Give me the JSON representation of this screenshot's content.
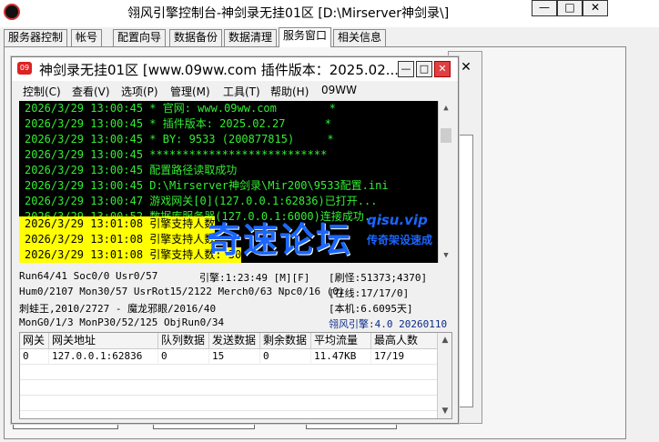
{
  "outer": {
    "title": "翎风引擎控制台-神剑录无挂01区 [D:\\Mirserver神剑录\\]",
    "tabs": [
      "服务器控制",
      "帐号",
      "配置向导",
      "数据备份",
      "数据清理",
      "服务窗口",
      "相关信息"
    ],
    "active_tab": "服务窗口",
    "min_label": "—",
    "max_label": "□",
    "close_label": "✕"
  },
  "inner": {
    "title": "神剑录无挂01区 [www.09ww.com 插件版本：2025.02....",
    "icon_label": "09",
    "menu": [
      "控制(C)",
      "查看(V)",
      "选项(P)",
      "管理(M)",
      "工具(T)",
      "帮助(H)",
      "09WW"
    ],
    "log": [
      {
        "text": "2026/3/29 13:00:45 * 官网: www.09ww.com        *",
        "hl": false
      },
      {
        "text": "2026/3/29 13:00:45 * 插件版本: 2025.02.27      *",
        "hl": false
      },
      {
        "text": "2026/3/29 13:00:45 * BY: 9533 (200877815)     *",
        "hl": false
      },
      {
        "text": "2026/3/29 13:00:45 ***************************",
        "hl": false
      },
      {
        "text": "2026/3/29 13:00:45 配置路径读取成功",
        "hl": false
      },
      {
        "text": "2026/3/29 13:00:45 D:\\Mirserver神剑录\\Mir200\\9533配置.ini",
        "hl": false
      },
      {
        "text": "2026/3/29 13:00:47 游戏网关[0](127.0.0.1:62836)已打开...",
        "hl": false
      },
      {
        "text": "2026/3/29 13:00:52 数据库服务器(127.0.0.1:6000)连接成功...",
        "hl": false
      },
      {
        "text": "2026/3/29 13:01:08 引擎支持人数",
        "hl": true
      },
      {
        "text": "2026/3/29 13:01:08 引擎支持人数",
        "hl": true
      },
      {
        "text": "2026/3/29 13:01:08 引擎支持人数: 30",
        "hl": true
      }
    ],
    "watermark": {
      "main": "奇速论坛",
      "url": "qisu.vip",
      "sub": "传奇架设速成"
    },
    "stats": {
      "run": "Run64/41 Soc0/0 Usr0/57",
      "engine": "引擎:1:23:49 [M][F]",
      "monsters": "[刷怪:51373;4370]",
      "hum": "Hum0/2107 Mon30/57 UsrRot15/2122 Merch0/63 Npc0/16 (0)",
      "online": "[在线:17/17/0]",
      "boss": "刺蛙王,2010/2727 - 魔龙邪眼/2016/40",
      "local": "[本机:6.6095天]",
      "mongo": "MonG0/1/3 MonP30/52/125 ObjRun0/34",
      "version": "翎风引擎:4.0 20260110"
    },
    "grid": {
      "headers": [
        "网关",
        "网关地址",
        "队列数据",
        "发送数据",
        "剩余数据",
        "平均流量",
        "最高人数"
      ],
      "rows": [
        [
          "0",
          "127.0.0.1:62836",
          "0",
          "15",
          "0",
          "11.47KB",
          "17/19"
        ]
      ]
    }
  },
  "colors": {
    "log_bg": "#000000",
    "log_text": "#33ee33",
    "highlight": "#ffff00",
    "accent": "#1a66ff",
    "close_red": "#e04040"
  }
}
